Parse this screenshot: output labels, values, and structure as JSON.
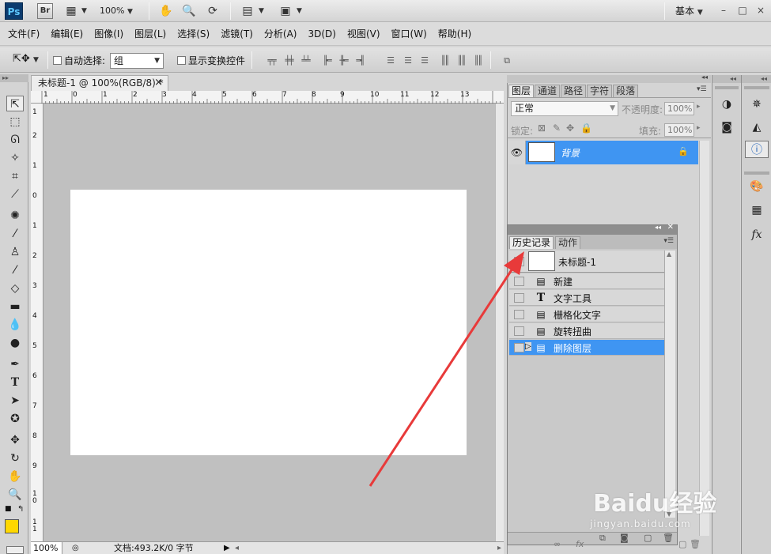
{
  "appbar": {
    "logo": "Ps",
    "bridge": "Br",
    "zoom": "100%",
    "workspace": "基本",
    "win_minimize": "–",
    "win_restore": "□",
    "win_close": "×"
  },
  "menu": [
    "文件(F)",
    "编辑(E)",
    "图像(I)",
    "图层(L)",
    "选择(S)",
    "滤镜(T)",
    "分析(A)",
    "3D(D)",
    "视图(V)",
    "窗口(W)",
    "帮助(H)"
  ],
  "options": {
    "auto_select_label": "自动选择:",
    "auto_select_value": "组",
    "show_transform_label": "显示变换控件"
  },
  "document": {
    "tab_title": "未标题-1 @ 100%(RGB/8) *",
    "close": "×",
    "zoom": "100%",
    "status": "文档:493.2K/0 字节",
    "ruler_h_labels": [
      "1",
      "0",
      "1",
      "2",
      "3",
      "4",
      "5",
      "6",
      "7",
      "8",
      "9",
      "10",
      "11",
      "12",
      "13"
    ],
    "ruler_v_labels": [
      "1",
      "2",
      "1",
      "0",
      "1",
      "2",
      "3",
      "4",
      "5",
      "6",
      "7",
      "8",
      "9",
      "1 0",
      "1 1"
    ]
  },
  "layers_panel": {
    "tabs": [
      "图层",
      "通道",
      "路径",
      "字符",
      "段落"
    ],
    "blend_mode": "正常",
    "opacity_label": "不透明度:",
    "opacity_value": "100%",
    "lock_label": "锁定:",
    "fill_label": "填充:",
    "fill_value": "100%",
    "layer_name": "背景"
  },
  "history_panel": {
    "tabs": [
      "历史记录",
      "动作"
    ],
    "snapshot_label": "未标题-1",
    "steps": [
      {
        "label": "新建",
        "icon": "history-doc-icon"
      },
      {
        "label": "文字工具",
        "icon": "type-tool-icon"
      },
      {
        "label": "栅格化文字",
        "icon": "history-doc-icon"
      },
      {
        "label": "旋转扭曲",
        "icon": "history-doc-icon"
      },
      {
        "label": "删除图层",
        "icon": "history-doc-icon"
      }
    ],
    "selected_index": 4
  },
  "watermark": {
    "title": "Baidu经验",
    "url": "jingyan.baidu.com"
  },
  "colors": {
    "selection_blue": "#3f95f2",
    "foreground_color": "#ffd800",
    "arrow_red": "#e83a3a"
  }
}
